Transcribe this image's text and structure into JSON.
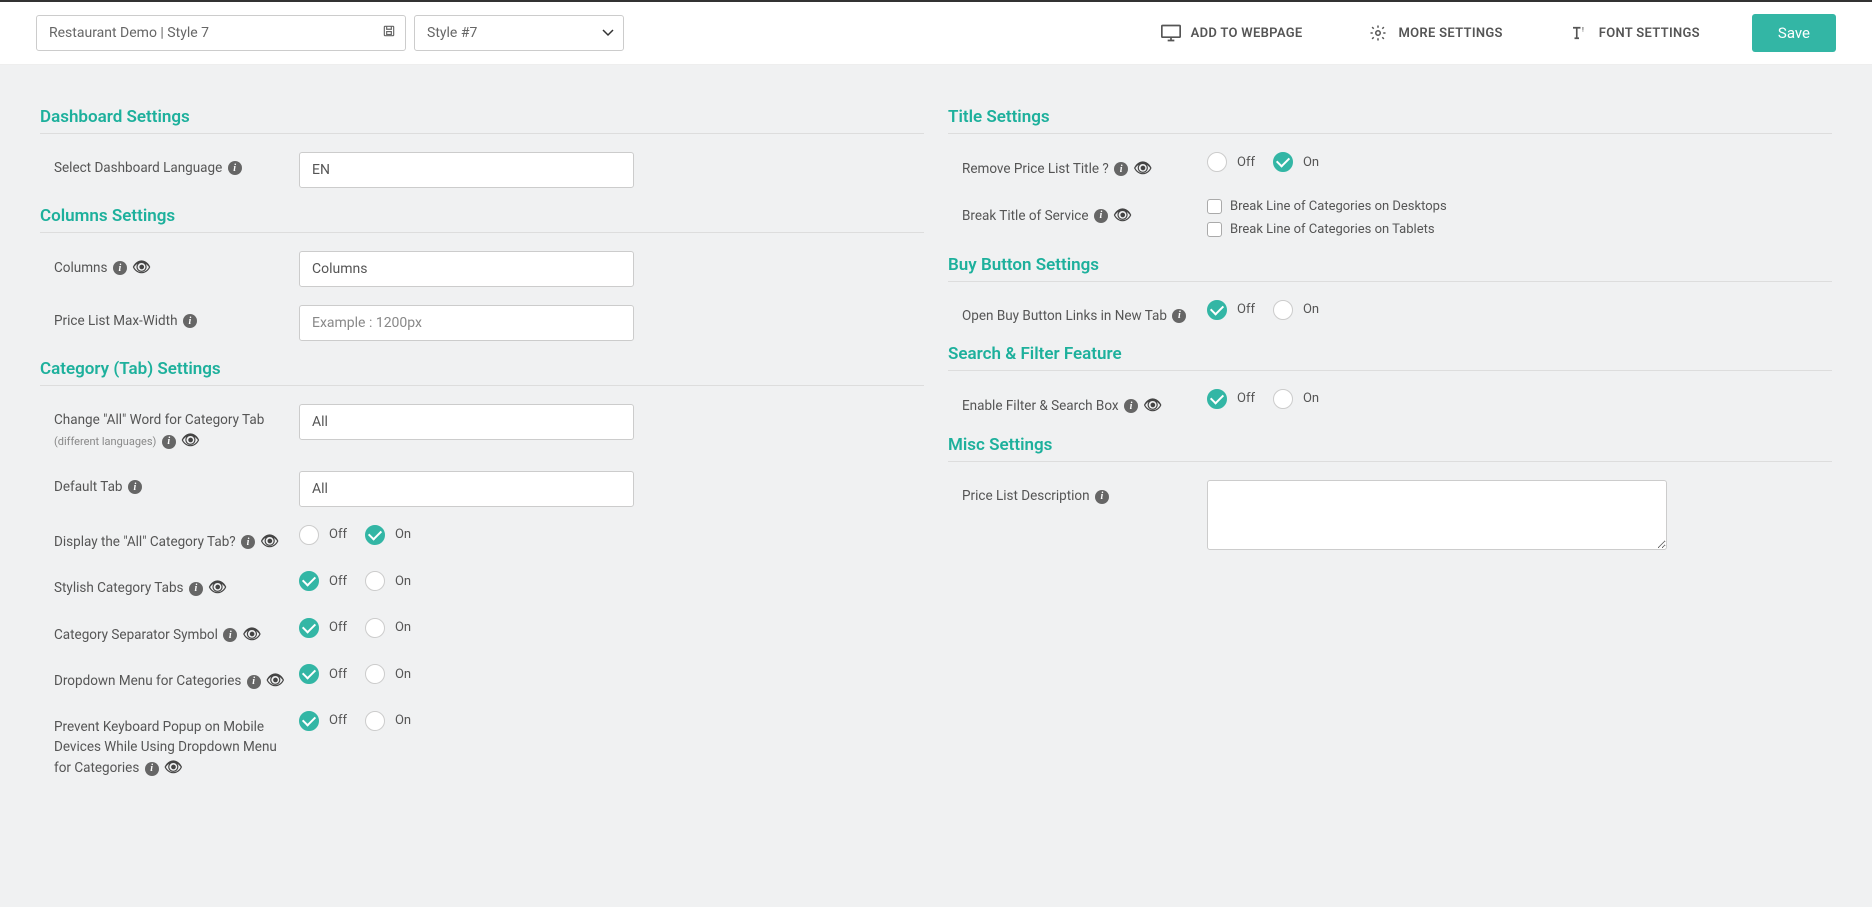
{
  "header": {
    "name_value": "Restaurant Demo | Style 7",
    "style_value": "Style #7",
    "add_to_webpage": "ADD TO WEBPAGE",
    "more_settings": "MORE SETTINGS",
    "font_settings": "FONT SETTINGS",
    "save": "Save"
  },
  "left": {
    "dashboard_settings_title": "Dashboard Settings",
    "select_dashboard_language": "Select Dashboard Language",
    "dashboard_language_value": "EN",
    "columns_settings_title": "Columns Settings",
    "columns_label": "Columns",
    "columns_value": "Columns",
    "max_width_label": "Price List Max-Width",
    "max_width_placeholder": "Example : 1200px",
    "category_settings_title": "Category (Tab) Settings",
    "change_all_word_label": "Change \"All\" Word for Category Tab",
    "change_all_word_sub": "(different languages)",
    "change_all_word_value": "All",
    "default_tab_label": "Default Tab",
    "default_tab_value": "All",
    "display_all_tab_label": "Display the \"All\" Category Tab?",
    "stylish_tabs_label": "Stylish Category Tabs",
    "separator_label": "Category Separator Symbol",
    "dropdown_label": "Dropdown Menu for Categories",
    "prevent_keyboard_label": "Prevent Keyboard Popup on Mobile Devices While Using Dropdown Menu for Categories"
  },
  "right": {
    "title_settings_title": "Title Settings",
    "remove_pricelist_title_label": "Remove Price List Title ?",
    "break_title_label": "Break Title of Service",
    "chk_desktop": "Break Line of Categories on Desktops",
    "chk_tablet": "Break Line of Categories on Tablets",
    "buy_button_title": "Buy Button Settings",
    "open_buy_label": "Open Buy Button Links in New Tab",
    "search_filter_title": "Search & Filter Feature",
    "enable_filter_label": "Enable Filter & Search Box",
    "misc_title": "Misc Settings",
    "description_label": "Price List Description"
  },
  "common": {
    "off": "Off",
    "on": "On"
  }
}
